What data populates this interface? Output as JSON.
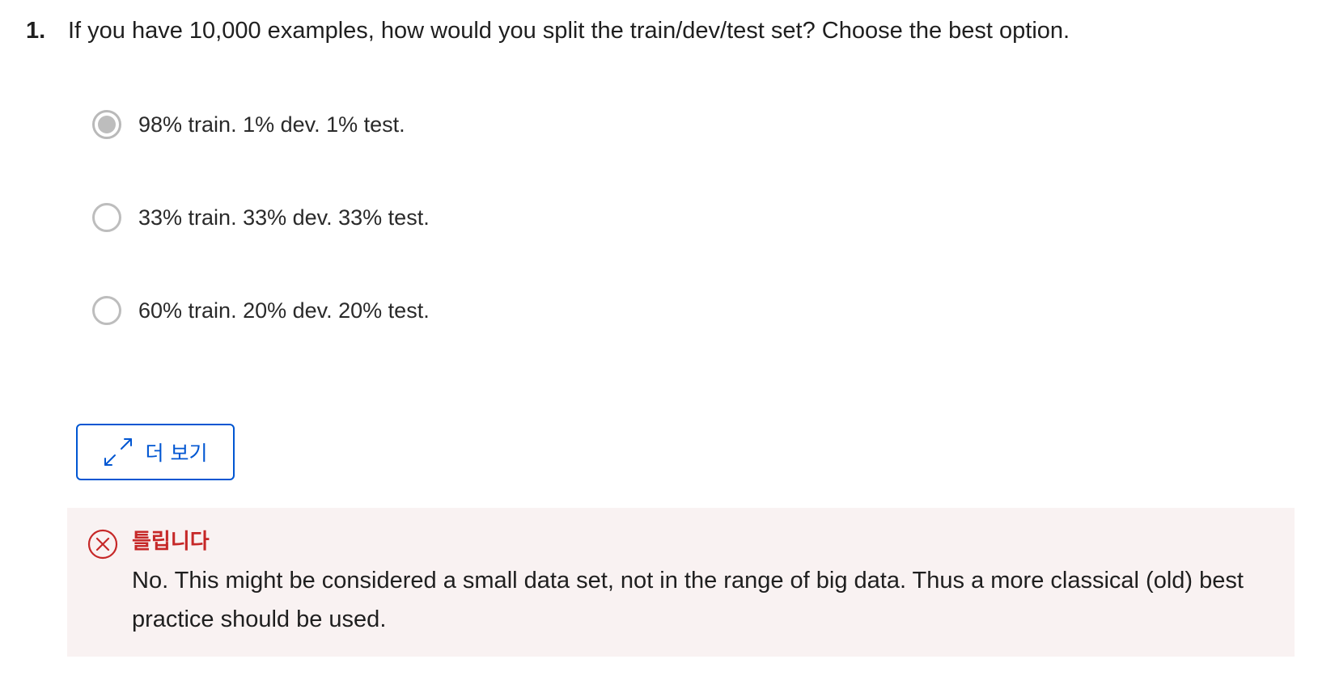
{
  "question": {
    "number": "1.",
    "text": "If you have 10,000 examples, how would you split the train/dev/test set? Choose the best option."
  },
  "options": [
    {
      "label": "98% train. 1% dev. 1% test.",
      "selected": true
    },
    {
      "label": "33% train. 33% dev. 33% test.",
      "selected": false
    },
    {
      "label": "60% train. 20% dev. 20% test.",
      "selected": false
    }
  ],
  "more_button": {
    "label": "더 보기",
    "icon": "expand-icon"
  },
  "feedback": {
    "status": "틀립니다",
    "icon": "x-circle-icon",
    "message": "No. This might be considered a small data set, not in the range of big data. Thus a more classical (old) best practice should be used."
  },
  "colors": {
    "accent": "#0056d2",
    "error": "#c62828",
    "feedback_bg": "#f9f2f2",
    "radio_gray": "#bdbdbd"
  }
}
